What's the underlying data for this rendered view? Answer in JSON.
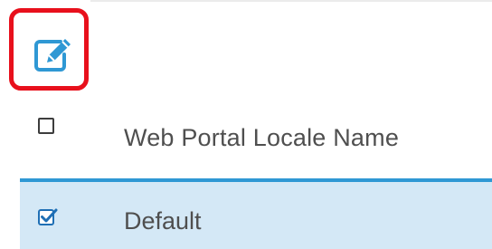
{
  "toolbar": {
    "edit_icon": "edit-pencil-icon",
    "highlight_color": "#e8101c",
    "icon_color": "#2f98d4"
  },
  "table": {
    "columns": [
      "Web Portal Locale Name"
    ],
    "rows": [
      {
        "name": "Default",
        "selected": true
      }
    ],
    "header_checked": false,
    "selected_row_color": "#d4e8f6",
    "accent_color": "#2f98d4"
  }
}
